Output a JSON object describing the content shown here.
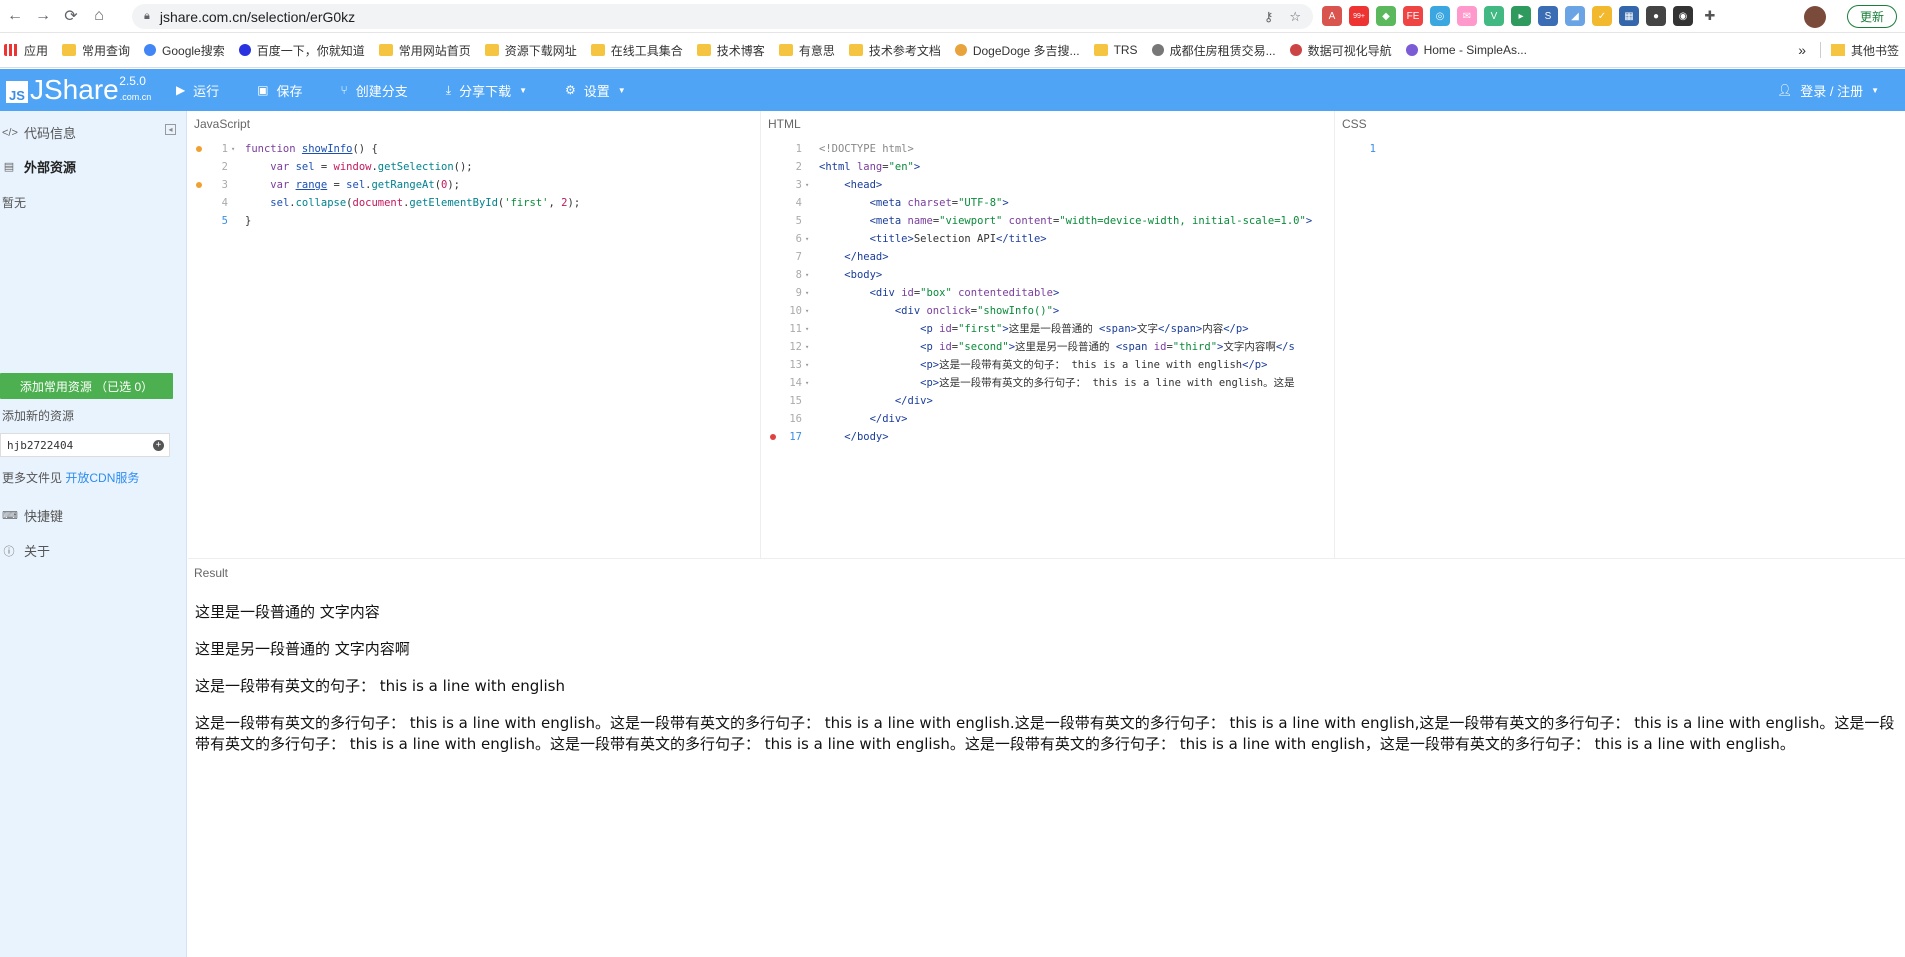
{
  "browser": {
    "url": "jshare.com.cn/selection/erG0kz",
    "update_label": "更新",
    "badge": "99+"
  },
  "bookmarks": [
    {
      "label": "应用"
    },
    {
      "label": "常用查询"
    },
    {
      "label": "Google搜索"
    },
    {
      "label": "百度一下，你就知道"
    },
    {
      "label": "常用网站首页"
    },
    {
      "label": "资源下载网址"
    },
    {
      "label": "在线工具集合"
    },
    {
      "label": "技术博客"
    },
    {
      "label": "有意思"
    },
    {
      "label": "技术参考文档"
    },
    {
      "label": "DogeDoge 多吉搜..."
    },
    {
      "label": "TRS"
    },
    {
      "label": "成都住房租赁交易..."
    },
    {
      "label": "数据可视化导航"
    },
    {
      "label": "Home - SimpleAs..."
    }
  ],
  "bookmarks_more": "»",
  "other_bookmarks": "其他书签",
  "app": {
    "logo_js": "JS",
    "logo_name": "JShare",
    "logo_domain": ".com.cn",
    "version": "2.5.0",
    "run": "运行",
    "save": "保存",
    "branch": "创建分支",
    "share": "分享下载",
    "settings": "设置",
    "login": "登录 / 注册"
  },
  "sidebar": {
    "code_info": "代码信息",
    "external_resources": "外部资源",
    "none": "暂无",
    "add_common": "添加常用资源 （已选 0）",
    "add_new": "添加新的资源",
    "resource_value": "hjb2722404",
    "more_files_prefix": "更多文件见",
    "cdn_link": "开放CDN服务",
    "shortcuts": "快捷键",
    "about": "关于"
  },
  "panes": {
    "js_label": "JavaScript",
    "html_label": "HTML",
    "css_label": "CSS"
  },
  "js_code": {
    "l1_kw": "function ",
    "l1_fn": "showInfo",
    "l1_rest": "() {",
    "l2_kw": "var ",
    "l2_v": "sel",
    "l2_eq": " = ",
    "l2_obj": "window",
    "l2_dot": ".",
    "l2_m": "getSelection",
    "l2_end": "();",
    "l3_kw": "var ",
    "l3_v": "range",
    "l3_eq": " = ",
    "l3_obj": "sel",
    "l3_dot": ".",
    "l3_m": "getRangeAt",
    "l3_p": "(",
    "l3_n": "0",
    "l3_end": ");",
    "l4_obj": "sel",
    "l4_dot": ".",
    "l4_m": "collapse",
    "l4_p": "(",
    "l4_doc": "document",
    "l4_dot2": ".",
    "l4_m2": "getElementById",
    "l4_p2": "(",
    "l4_s": "'first'",
    "l4_c": ", ",
    "l4_n": "2",
    "l4_end": ");",
    "l5": "}"
  },
  "html_code": {
    "l1": "<!DOCTYPE html>",
    "l2a": "<html ",
    "l2b": "lang",
    "l2c": "=",
    "l2d": "\"en\"",
    "l2e": ">",
    "l3": "<head>",
    "l4a": "<meta ",
    "l4b": "charset",
    "l4c": "=",
    "l4d": "\"UTF-8\"",
    "l4e": ">",
    "l5a": "<meta ",
    "l5b": "name",
    "l5c": "=",
    "l5d": "\"viewport\"",
    "l5f": " content",
    "l5g": "=",
    "l5h": "\"width=device-width, initial-scale=1.0\"",
    "l5i": ">",
    "l6a": "<title>",
    "l6b": "Selection API",
    "l6c": "</title>",
    "l7": "</head>",
    "l8": "<body>",
    "l9a": "<div ",
    "l9b": "id",
    "l9c": "=",
    "l9d": "\"box\"",
    "l9e": " contenteditable",
    "l9f": ">",
    "l10a": "<div ",
    "l10b": "onclick",
    "l10c": "=",
    "l10d": "\"showInfo()\"",
    "l10e": ">",
    "l11a": "<p ",
    "l11b": "id",
    "l11c": "=",
    "l11d": "\"first\"",
    "l11e": ">",
    "l11f": "这里是一段普通的 ",
    "l11g": "<span>",
    "l11h": "文字",
    "l11i": "</span>",
    "l11j": "内容",
    "l11k": "</p>",
    "l12a": "<p ",
    "l12b": "id",
    "l12c": "=",
    "l12d": "\"second\"",
    "l12e": ">",
    "l12f": "这里是另一段普通的 ",
    "l12g": "<span ",
    "l12h": "id",
    "l12i": "=",
    "l12j": "\"third\"",
    "l12k": ">",
    "l12l": "文字内容啊",
    "l12m": "</s",
    "l13a": "<p>",
    "l13b": "这是一段带有英文的句子： this is a line with english",
    "l13c": "</p>",
    "l14a": "<p>",
    "l14b": "这是一段带有英文的多行句子： this is a line with english。这是",
    "l15": "</div>",
    "l16": "</div>",
    "l17": "</body>"
  },
  "css_code": {
    "l1": "1"
  },
  "result": {
    "label": "Result",
    "p1": "这里是一段普通的 文字内容",
    "p2": "这里是另一段普通的 文字内容啊",
    "p3": "这是一段带有英文的句子： this is a line with english",
    "p4": "这是一段带有英文的多行句子： this is a line with english。这是一段带有英文的多行句子： this is a line with english.这是一段带有英文的多行句子： this is a line with english,这是一段带有英文的多行句子： this is a line with english。这是一段带有英文的多行句子： this is a line with english。这是一段带有英文的多行句子： this is a line with english。这是一段带有英文的多行句子： this is a line with english，这是一段带有英文的多行句子： this is a line with english。"
  },
  "colors": {
    "header": "#4fa4f5",
    "sidebar": "#e9f3fd",
    "add_button": "#4cb050",
    "breakpoint_orange": "#f0a030",
    "breakpoint_red": "#e04040"
  }
}
